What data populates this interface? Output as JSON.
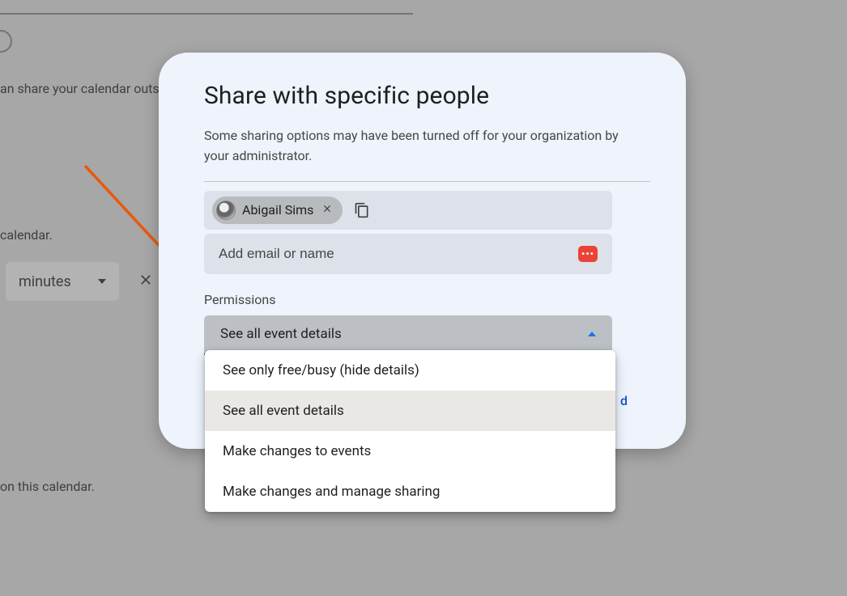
{
  "bg": {
    "share_outside": "an share your calendar outsi",
    "calendar": "calendar.",
    "on_calendar": "on this calendar.",
    "minutes": "minutes"
  },
  "dialog": {
    "title": "Share with specific people",
    "note": "Some sharing options may have been turned off for your organization by your administrator.",
    "chip_name": "Abigail Sims",
    "input_placeholder": "Add email or name",
    "perm_label": "Permissions",
    "selected": "See all event details",
    "send_partial": "d"
  },
  "dropdown": {
    "options": [
      "See only free/busy (hide details)",
      "See all event details",
      "Make changes to events",
      "Make changes and manage sharing"
    ]
  }
}
